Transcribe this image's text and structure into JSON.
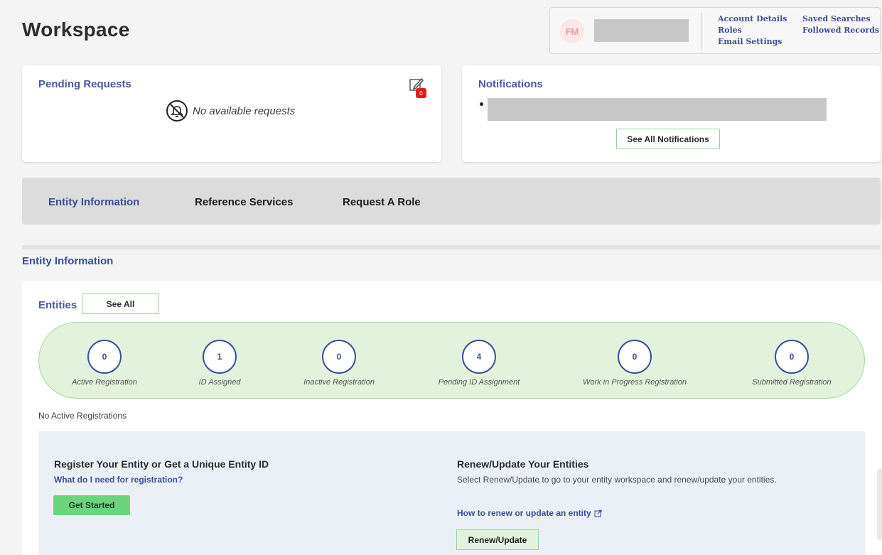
{
  "header": {
    "title": "Workspace",
    "account": {
      "initials": "FM",
      "links_col1": [
        "Account Details",
        "Roles",
        "Email Settings"
      ],
      "links_col2": [
        "Saved Searches",
        "Followed Records"
      ]
    }
  },
  "pending": {
    "title": "Pending Requests",
    "empty_text": "No available requests",
    "badge_count": "0"
  },
  "notifications": {
    "title": "Notifications",
    "see_all_label": "See All Notifications"
  },
  "tabs": [
    {
      "label": "Entity Information",
      "active": true
    },
    {
      "label": "Reference Services",
      "active": false
    },
    {
      "label": "Request A Role",
      "active": false
    }
  ],
  "section": {
    "heading": "Entity Information"
  },
  "entities": {
    "label": "Entities",
    "see_all_label": "See All",
    "stats": [
      {
        "value": "0",
        "label": "Active Registration"
      },
      {
        "value": "1",
        "label": "ID Assigned"
      },
      {
        "value": "0",
        "label": "Inactive Registration"
      },
      {
        "value": "4",
        "label": "Pending ID Assignment"
      },
      {
        "value": "0",
        "label": "Work in Progress Registration"
      },
      {
        "value": "0",
        "label": "Submitted Registration"
      }
    ],
    "no_active_text": "No Active Registrations"
  },
  "register": {
    "title": "Register Your Entity or Get a Unique Entity ID",
    "link": "What do I need for registration?",
    "button": "Get Started"
  },
  "renew": {
    "title": "Renew/Update Your Entities",
    "description": "Select Renew/Update to go to your entity workspace and renew/update your entities.",
    "link": "How to renew or update an entity",
    "button": "Renew/Update"
  },
  "colors": {
    "accent": "#3c4f96",
    "green": "#6dd47e",
    "badge": "#e31c1c"
  }
}
